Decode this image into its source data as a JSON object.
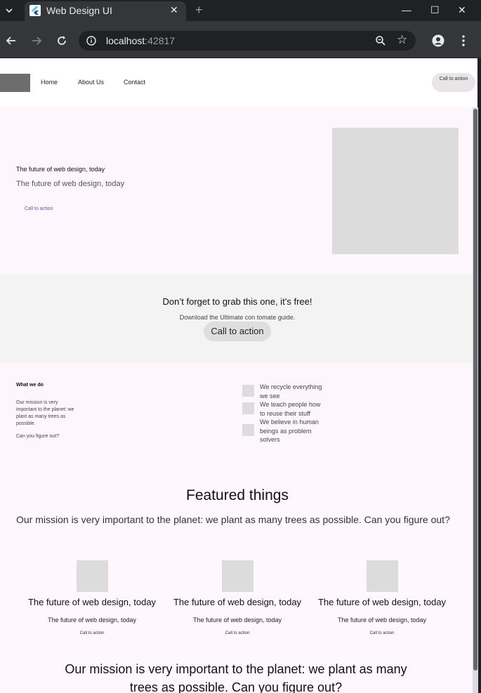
{
  "browser": {
    "tab_title": "Web Design UI",
    "url_host": "localhost",
    "url_port": ":42817"
  },
  "nav": {
    "links": [
      "Home",
      "About Us",
      "Contact"
    ],
    "cta": "Call to action"
  },
  "hero": {
    "title": "The future of web design, today",
    "subtitle": "The future of web design, today",
    "cta": "Call to action"
  },
  "banner": {
    "title": "Don’t forget to grab this one, it’s free!",
    "subtitle": "Download the Ultimate con tomate guide.",
    "cta": "Call to action"
  },
  "what": {
    "title": "What we do",
    "body": "Our mission is very important to the planet: we plant as many trees as possible.",
    "question": "Can you figure out?",
    "items": [
      "We recycle everything we see",
      "We teach people how to reuse their stuff",
      "We believe in human beings as problem solvers"
    ]
  },
  "featured": {
    "title": "Featured things",
    "body": "Our mission is very important to the planet: we plant as many trees as possible. Can you figure out?",
    "cards": [
      {
        "title": "The future of web design, today",
        "subtitle": "The future of web design, today",
        "cta": "Call to action"
      },
      {
        "title": "The future of web design, today",
        "subtitle": "The future of web design, today",
        "cta": "Call to action"
      },
      {
        "title": "The future of web design, today",
        "subtitle": "The future of web design, today",
        "cta": "Call to action"
      }
    ]
  },
  "bottom": {
    "text": "Our mission is very important to the planet: we plant as many trees as possible. Can you figure out?"
  }
}
